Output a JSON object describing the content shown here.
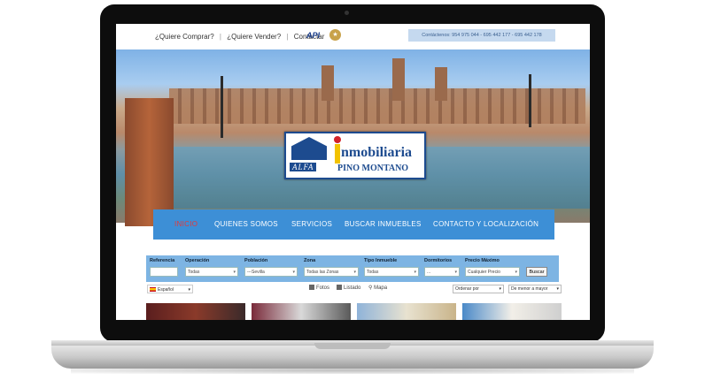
{
  "topbar": {
    "links": [
      "¿Quiere Comprar?",
      "¿Quiere Vender?",
      "Contactar"
    ],
    "separator": "|",
    "api_logo": "API",
    "contact": "Contáctenos: 954 975 044 - 695 442 177 - 695 442 178"
  },
  "hero": {
    "logo_word": "nmobiliaria",
    "logo_alfa": "ALFA",
    "logo_pino": "PINO MONTANO"
  },
  "nav": {
    "items": [
      "INICIO",
      "QUIENES SOMOS",
      "SERVICIOS",
      "BUSCAR INMUEBLES",
      "CONTACTO Y LOCALIZACIÓN"
    ],
    "active_color": "#e23a3a",
    "bar_color": "#3d8fd6"
  },
  "search": {
    "fields": [
      {
        "label": "Referencia",
        "value": ""
      },
      {
        "label": "Operación",
        "value": "Todas"
      },
      {
        "label": "Población",
        "value": "---Sevilla"
      },
      {
        "label": "Zona",
        "value": "Todas las Zonas"
      },
      {
        "label": "Tipo Inmueble",
        "value": "Todas"
      },
      {
        "label": "Dormitorios",
        "value": "..."
      },
      {
        "label": "Precio Máximo",
        "value": "Cualquier Precio"
      }
    ],
    "button": "Buscar"
  },
  "options": {
    "language": "Español",
    "view_photos": "Fotos",
    "view_list": "Listado",
    "view_map": "Mapa",
    "order_by": "Ordenar por",
    "order_dir": "De menor a mayor"
  }
}
